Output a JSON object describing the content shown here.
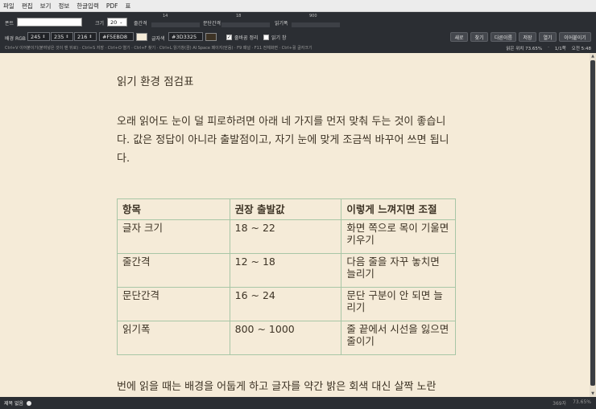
{
  "menu": [
    "파일",
    "편집",
    "보기",
    "정보",
    "한글입력",
    "PDF",
    "표"
  ],
  "toolbar": {
    "font_label": "폰트",
    "font_value": "",
    "size_label": "크기",
    "size_value": "20",
    "line_spacing_label": "줄간격",
    "line_spacing_value": "14",
    "para_spacing_label": "문단간격",
    "para_spacing_value": "18",
    "read_width_label": "읽기폭",
    "read_width_value": "900",
    "bg_label": "배경 RGB",
    "bg_r": "245",
    "bg_g": "235",
    "bg_b": "216",
    "bg_hex": "#F5EBD8",
    "text_color_label": "글자색",
    "text_hex": "#3D3325",
    "wrap_label": "줄바꿈 정리",
    "wrap_checked": true,
    "read_window_label": "읽기 창",
    "read_window_checked": false,
    "buttons": [
      "새로",
      "찾기",
      "다른이름",
      "저장",
      "열기",
      "이어붙이기"
    ],
    "hint": "Ctrl+V 이어붙이기(붙여넣은 것이 맨 뒤로) · Ctrl+S 저장 · Ctrl+O 열기 · Ctrl+F 찾기 · Ctrl+L 읽기창(끔) AI Space 페이지(닫음) · F9 패널 · F11 전체화면 · Ctrl+휠 글자크기",
    "position_label": "읽은 위치 73.65%",
    "page_label": "1/1쪽",
    "time_label": "오전 5:48"
  },
  "colors": {
    "background": "#F5EBD8",
    "text": "#3D3325",
    "table_border": "#a8c6a6",
    "toolbar": "#2b2e33"
  },
  "document": {
    "title": "읽기 환경 점검표",
    "intro": "오래 읽어도 눈이 덜 피로하려면 아래 네 가지를 먼저 맞춰 두는 것이 좋습니다. 값은 정답이 아니라 출발점이고, 자기 눈에 맞게 조금씩 바꾸어 쓰면 됩니다.",
    "table": {
      "headers": [
        "항목",
        "권장 출발값",
        "이렇게 느껴지면 조절"
      ],
      "rows": [
        [
          "글자 크기",
          "18 ~ 22",
          "화면 쪽으로 목이 기울면 키우기"
        ],
        [
          "줄간격",
          "12 ~ 18",
          "다음 줄을 자꾸 놓치면 늘리기"
        ],
        [
          "문단간격",
          "16 ~ 24",
          "문단 구분이 안 되면 늘리기"
        ],
        [
          "읽기폭",
          "800 ~ 1000",
          "줄 끝에서 시선을 잃으면 줄이기"
        ]
      ]
    },
    "cut_text": "번에 읽을 때는 배경을 어둡게 하고 글자를 약간 밝은 회색 대신 살짝 노란"
  },
  "status": {
    "doc_name": "제목 없음",
    "char_count": "369자",
    "percent": "73.65%"
  }
}
